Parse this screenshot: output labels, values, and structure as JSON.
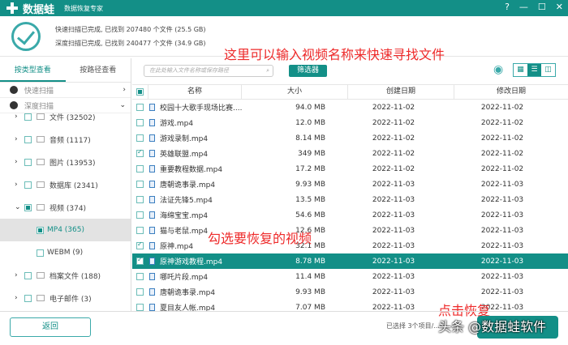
{
  "app": {
    "name": "数据蛙",
    "subtitle": "数据恢复专家",
    "help_icon": "?",
    "min_icon": "—",
    "max_icon": "☐",
    "close_icon": "✕"
  },
  "status": {
    "quick": "快速扫描已完成, 已找到 207480 个文件 (25.5 GB)",
    "deep": "深度扫描已完成, 已找到 240477 个文件 (34.9 GB)"
  },
  "notes": {
    "search": "这里可以输入视频名称来快速寻找文件",
    "select": "勾选要恢复的视频",
    "recover": "点击恢复"
  },
  "left": {
    "tabs": [
      "按类型查看",
      "按路径查看"
    ],
    "scans": [
      "快速扫描",
      "深度扫描"
    ],
    "tree": [
      {
        "label": "文件 (32502)"
      },
      {
        "label": "音频 (1117)"
      },
      {
        "label": "图片 (13953)"
      },
      {
        "label": "数据库 (2341)"
      },
      {
        "label": "视频 (374)"
      },
      {
        "label": "MP4 (365)"
      },
      {
        "label": "WEBM (9)"
      },
      {
        "label": "档案文件 (188)"
      },
      {
        "label": "电子邮件 (3)"
      }
    ]
  },
  "toolbar": {
    "search_placeholder": "在此处输入文件名称或保存路径",
    "filter": "筛选器"
  },
  "table": {
    "headers": [
      "名称",
      "大小",
      "创建日期",
      "修改日期"
    ],
    "rows": [
      {
        "name": "校园十大歌手现场比赛....",
        "size": "94.0 MB",
        "created": "2022-11-02",
        "modified": "2022-11-02",
        "checked": false
      },
      {
        "name": "游戏.mp4",
        "size": "12.0 MB",
        "created": "2022-11-02",
        "modified": "2022-11-02",
        "checked": false
      },
      {
        "name": "游戏录制.mp4",
        "size": "8.14 MB",
        "created": "2022-11-02",
        "modified": "2022-11-02",
        "checked": false
      },
      {
        "name": "英雄联盟.mp4",
        "size": "349 MB",
        "created": "2022-11-02",
        "modified": "2022-11-02",
        "checked": true
      },
      {
        "name": "重要教程数据.mp4",
        "size": "17.2 MB",
        "created": "2022-11-02",
        "modified": "2022-11-02",
        "checked": false
      },
      {
        "name": "唐朝诡事录.mp4",
        "size": "9.93 MB",
        "created": "2022-11-03",
        "modified": "2022-11-03",
        "checked": false
      },
      {
        "name": "法证先锋5.mp4",
        "size": "13.5 MB",
        "created": "2022-11-03",
        "modified": "2022-11-03",
        "checked": false
      },
      {
        "name": "海绵宝宝.mp4",
        "size": "54.6 MB",
        "created": "2022-11-03",
        "modified": "2022-11-03",
        "checked": false
      },
      {
        "name": "猫与老鼠.mp4",
        "size": "12.6 MB",
        "created": "2022-11-03",
        "modified": "2022-11-03",
        "checked": false
      },
      {
        "name": "原神.mp4",
        "size": "32.1 MB",
        "created": "2022-11-03",
        "modified": "2022-11-03",
        "checked": true
      },
      {
        "name": "原神游戏教程.mp4",
        "size": "8.78 MB",
        "created": "2022-11-03",
        "modified": "2022-11-03",
        "checked": true
      },
      {
        "name": "哪吒片段.mp4",
        "size": "11.4 MB",
        "created": "2022-11-03",
        "modified": "2022-11-03",
        "checked": false
      },
      {
        "name": "唐朝诡事录.mp4",
        "size": "9.93 MB",
        "created": "2022-11-03",
        "modified": "2022-11-03",
        "checked": false
      },
      {
        "name": "夏目友人帐.mp4",
        "size": "7.07 MB",
        "created": "2022-11-03",
        "modified": "2022-11-03",
        "checked": false
      }
    ]
  },
  "bottom": {
    "back": "返回",
    "selected": "已选择 3个项目/..."
  },
  "watermark": "头条 @数据蛙软件",
  "colors": {
    "accent": "#138f87",
    "note": "#ee2a2a"
  }
}
